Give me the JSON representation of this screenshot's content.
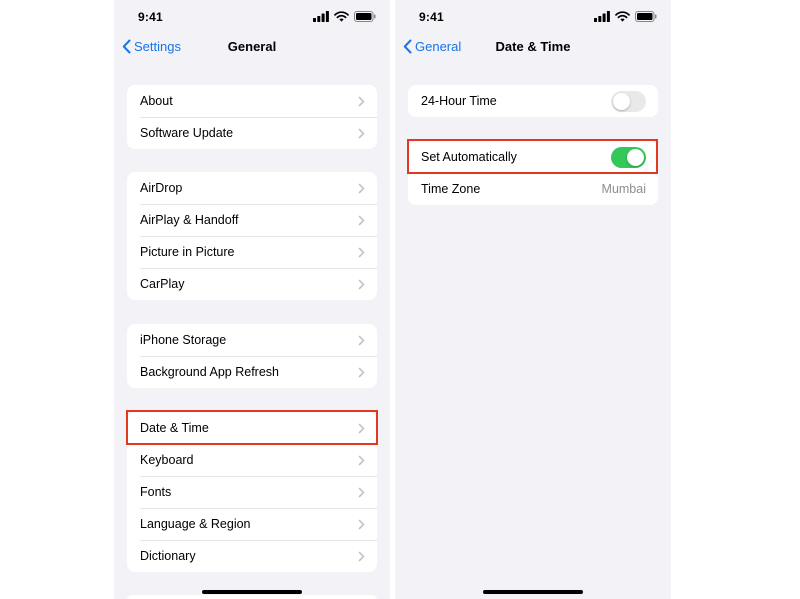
{
  "left_screen": {
    "status": {
      "time": "9:41"
    },
    "nav": {
      "back_label": "Settings",
      "title": "General"
    },
    "groups": [
      {
        "items": [
          {
            "label": "About"
          },
          {
            "label": "Software Update"
          }
        ]
      },
      {
        "items": [
          {
            "label": "AirDrop"
          },
          {
            "label": "AirPlay & Handoff"
          },
          {
            "label": "Picture in Picture"
          },
          {
            "label": "CarPlay"
          }
        ]
      },
      {
        "items": [
          {
            "label": "iPhone Storage"
          },
          {
            "label": "Background App Refresh"
          }
        ]
      },
      {
        "items": [
          {
            "label": "Date & Time"
          },
          {
            "label": "Keyboard"
          },
          {
            "label": "Fonts"
          },
          {
            "label": "Language & Region"
          },
          {
            "label": "Dictionary"
          }
        ]
      }
    ]
  },
  "right_screen": {
    "status": {
      "time": "9:41"
    },
    "nav": {
      "back_label": "General",
      "title": "Date & Time"
    },
    "groups": [
      {
        "items": [
          {
            "label": "24-Hour Time",
            "toggle": false
          }
        ]
      },
      {
        "items": [
          {
            "label": "Set Automatically",
            "toggle": true
          },
          {
            "label": "Time Zone",
            "value": "Mumbai"
          }
        ]
      }
    ]
  },
  "colors": {
    "accent": "#1a73e8",
    "toggle_on": "#34c759",
    "highlight": "#e0391f",
    "background": "#f2f2f7"
  },
  "icons": {
    "back": "chevron-left-icon",
    "disclosure": "chevron-right-icon",
    "signal": "cellular-signal-icon",
    "wifi": "wifi-icon",
    "battery": "battery-icon"
  }
}
